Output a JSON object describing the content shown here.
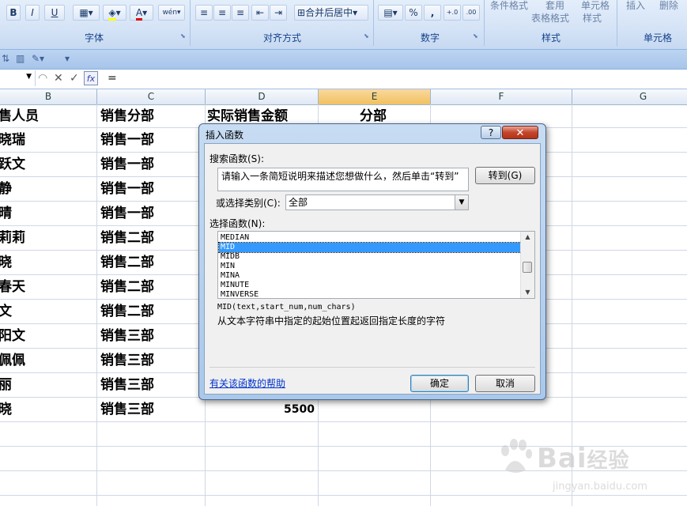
{
  "ribbon": {
    "font_group_label": "字体",
    "align_group_label": "对齐方式",
    "number_group_label": "数字",
    "style_group_label": "样式",
    "cell_group_label": "单元格",
    "merge_label": "合并后居中",
    "cond_format_label": "条件格式",
    "apply_label": "套用",
    "table_format_label": "表格格式",
    "cell_style_label": "单元格",
    "cell_style_label2": "样式",
    "insert_label": "插入",
    "delete_label": "删除",
    "bold": "B",
    "italic": "I",
    "underline": "U",
    "percent": "%",
    "comma": ","
  },
  "formula_bar": {
    "fx": "fx",
    "content": "="
  },
  "columns": [
    "B",
    "C",
    "D",
    "E",
    "F",
    "G"
  ],
  "header_row": {
    "b": "售人员",
    "c": "销售分部",
    "d": "实际销售金额",
    "e": "分部"
  },
  "rows": [
    {
      "b": "晓瑞",
      "c": "销售一部"
    },
    {
      "b": "跃文",
      "c": "销售一部"
    },
    {
      "b": "静",
      "c": "销售一部"
    },
    {
      "b": "晴",
      "c": "销售一部"
    },
    {
      "b": "莉莉",
      "c": "销售二部"
    },
    {
      "b": "晓",
      "c": "销售二部"
    },
    {
      "b": "春天",
      "c": "销售二部"
    },
    {
      "b": "文",
      "c": "销售二部"
    },
    {
      "b": "阳文",
      "c": "销售三部"
    },
    {
      "b": "佩佩",
      "c": "销售三部"
    },
    {
      "b": "丽",
      "c": "销售三部"
    },
    {
      "b": "晓",
      "c": "销售三部",
      "d": "5500"
    }
  ],
  "dialog": {
    "title": "插入函数",
    "help_btn": "?",
    "close_btn": "✕",
    "search_label": "搜索函数(S):",
    "search_value": "请输入一条简短说明来描述您想做什么，然后单击“转到”",
    "go_button": "转到(G)",
    "category_label": "或选择类别(C):",
    "category_value": "全部",
    "function_label": "选择函数(N):",
    "functions": [
      "MEDIAN",
      "MID",
      "MIDB",
      "MIN",
      "MINA",
      "MINUTE",
      "MINVERSE"
    ],
    "selected_function": "MID",
    "syntax": "MID(text,start_num,num_chars)",
    "description": "从文本字符串中指定的起始位置起返回指定长度的字符",
    "help_link": "有关该函数的帮助",
    "ok_button": "确定",
    "cancel_button": "取消"
  },
  "watermark": {
    "brand": "Bai",
    "brand_cn": "经验",
    "url": "jingyan.baidu.com"
  }
}
